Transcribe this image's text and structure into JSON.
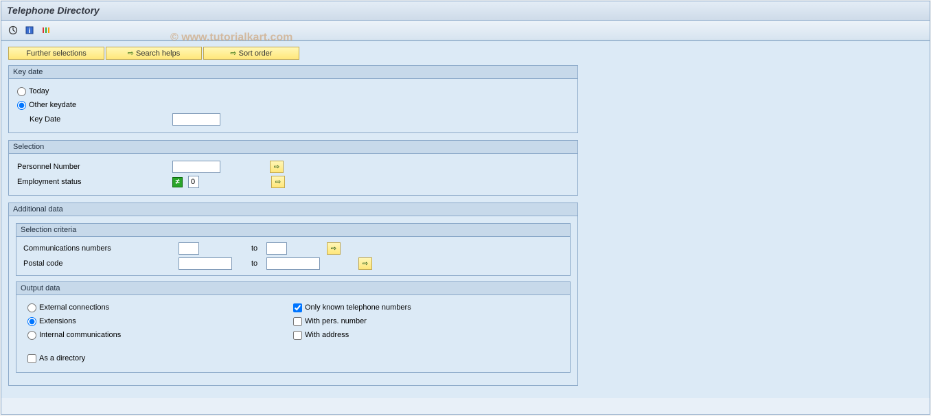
{
  "title": "Telephone Directory",
  "watermark": "© www.tutorialkart.com",
  "toolbar": {
    "icon1": "execute-icon",
    "icon2": "info-icon",
    "icon3": "variant-icon"
  },
  "buttons": {
    "further": "Further selections",
    "search": "Search helps",
    "sort": "Sort order"
  },
  "keydate": {
    "panel_title": "Key date",
    "today": "Today",
    "other": "Other keydate",
    "keydate_label": "Key Date",
    "keydate_value": ""
  },
  "selection": {
    "panel_title": "Selection",
    "personnel_label": "Personnel Number",
    "personnel_value": "",
    "employment_label": "Employment status",
    "employment_value": "0"
  },
  "additional": {
    "panel_title": "Additional data",
    "sel_criteria_title": "Selection criteria",
    "comm_label": "Communications numbers",
    "to_label": "to",
    "postal_label": "Postal code",
    "output_title": "Output data",
    "external": "External connections",
    "extensions": "Extensions",
    "internal": "Internal communications",
    "only_known": "Only known telephone numbers",
    "with_pers": "With pers. number",
    "with_address": "With address",
    "as_directory": "As a directory"
  }
}
